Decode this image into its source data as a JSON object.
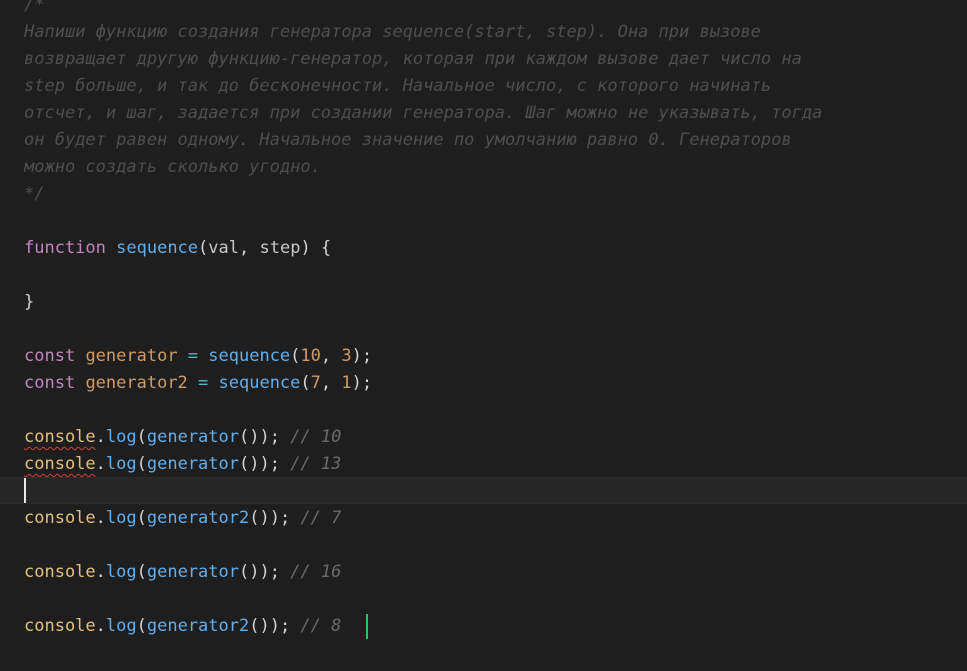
{
  "editor": {
    "comment": {
      "open": "/*",
      "lines": [
        "Напиши функцию создания генератора sequence(start, step). Она при вызове",
        "возвращает другую функцию-генератор, которая при каждом вызове дает число на",
        "step больше, и так до бесконечности. Начальное число, с которого начинать",
        "отсчет, и шаг, задается при создании генератора. Шаг можно не указывать, тогда",
        "он будет равен одному. Начальное значение по умолчанию равно 0. Генераторов",
        "можно создать сколько угодно."
      ],
      "close": "*/"
    },
    "function_decl": {
      "keyword": "function",
      "name": "sequence",
      "param1": "val",
      "param2": "step",
      "open": "(",
      "sep": ", ",
      "close_paren": ")",
      "brace_open": " {",
      "brace_close": "}"
    },
    "const1": {
      "keyword": "const",
      "name": "generator",
      "eq": " = ",
      "fn": "sequence",
      "arg1": "10",
      "arg2": "3",
      "tail": ");"
    },
    "const2": {
      "keyword": "const",
      "name": "generator2",
      "eq": " = ",
      "fn": "sequence",
      "arg1": "7",
      "arg2": "1",
      "tail": ");"
    },
    "logs": [
      {
        "obj": "console",
        "method": "log",
        "call": "generator",
        "comment": "// 10"
      },
      {
        "obj": "console",
        "method": "log",
        "call": "generator",
        "comment": "// 13"
      },
      {
        "obj": "console",
        "method": "log",
        "call": "generator2",
        "comment": "// 7"
      },
      {
        "obj": "console",
        "method": "log",
        "call": "generator",
        "comment": "// 16"
      },
      {
        "obj": "console",
        "method": "log",
        "call": "generator2",
        "comment": "// 8"
      }
    ]
  }
}
